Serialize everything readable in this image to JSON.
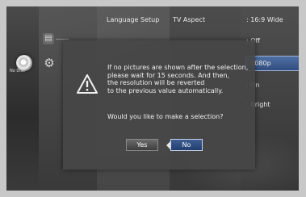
{
  "disc": {
    "status_label": "No Disc"
  },
  "menu": {
    "header": "Language Setup"
  },
  "settings": [
    {
      "name": "TV Aspect",
      "value": ": 16:9 Wide"
    },
    {
      "name": "",
      "value": ": Off"
    },
    {
      "name": "",
      "value": ": 1080p"
    },
    {
      "name": "",
      "value": ": On"
    },
    {
      "name": "",
      "value": ": Bright"
    }
  ],
  "dialog": {
    "message_lines": [
      "If no pictures are shown after the selection,",
      "please wait for 15 seconds. And then,",
      "the resolution will be reverted",
      "to the previous value automatically."
    ],
    "question": "Would you like to make a selection?",
    "yes_label": "Yes",
    "no_label": "No",
    "selected": "No"
  }
}
